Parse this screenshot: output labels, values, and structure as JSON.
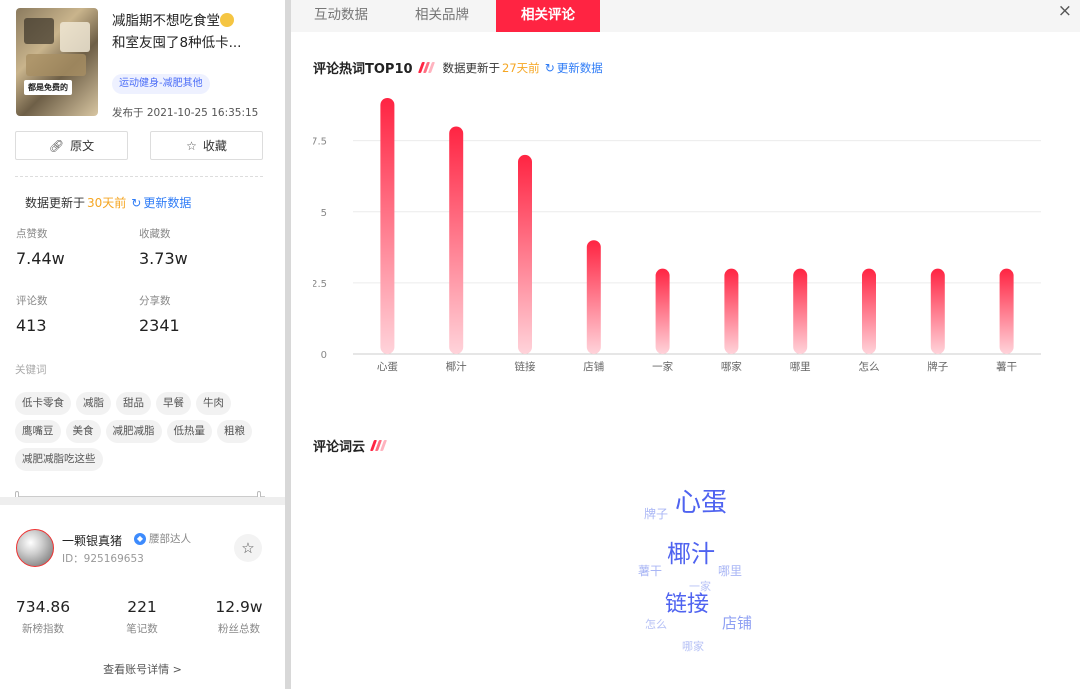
{
  "note": {
    "title": "减脂期不想吃食堂",
    "title_line2": "和室友囤了8种低卡...",
    "thumb_text": "都是免费的",
    "category": "运动健身-减肥其他",
    "publish_label": "发布于",
    "publish_time": "2021-10-25 16:35:15"
  },
  "actions": {
    "original": "原文",
    "favorite": "收藏"
  },
  "left_update": {
    "prefix": "数据更新于",
    "ago": "30天前",
    "refresh": "更新数据"
  },
  "stats": [
    {
      "label": "点赞数",
      "value": "7.44w"
    },
    {
      "label": "收藏数",
      "value": "3.73w"
    },
    {
      "label": "评论数",
      "value": "413"
    },
    {
      "label": "分享数",
      "value": "2341"
    }
  ],
  "keywords_label": "关键词",
  "keywords": [
    "低卡零食",
    "减脂",
    "甜品",
    "早餐",
    "牛肉",
    "鹰嘴豆",
    "美食",
    "减肥减脂",
    "低热量",
    "粗粮",
    "减肥减脂吃这些"
  ],
  "user": {
    "name": "一颗银真猪",
    "badge": "腰部达人",
    "id": "ID：925169653",
    "stats": [
      {
        "value": "734.86",
        "label": "新榜指数"
      },
      {
        "value": "221",
        "label": "笔记数"
      },
      {
        "value": "12.9w",
        "label": "粉丝总数"
      }
    ],
    "more": "查看账号详情 >"
  },
  "tabs": [
    "互动数据",
    "相关品牌",
    "相关评论"
  ],
  "close": "×",
  "hot_section": {
    "title": "评论热词TOP10",
    "update_prefix": "数据更新于",
    "ago": "27天前",
    "refresh": "更新数据"
  },
  "chart_data": {
    "type": "bar",
    "categories": [
      "心蛋",
      "椰汁",
      "链接",
      "店铺",
      "一家",
      "哪家",
      "哪里",
      "怎么",
      "牌子",
      "薯干"
    ],
    "values": [
      9,
      8,
      7,
      4,
      3,
      3,
      3,
      3,
      3,
      3
    ],
    "ylim": [
      0,
      9
    ],
    "yticks": [
      0,
      2.5,
      5,
      7.5
    ],
    "ytick_labels": [
      "0",
      "2.5",
      "5",
      "7.5"
    ],
    "grid": true,
    "colors": {
      "bar_top": "#ff2442",
      "bar_bottom": "#ffd3da"
    }
  },
  "cloud_section": {
    "title": "评论词云"
  },
  "word_cloud": [
    {
      "text": "心蛋",
      "size": 26,
      "color": "#4f63f0"
    },
    {
      "text": "椰汁",
      "size": 24,
      "color": "#4f63f0"
    },
    {
      "text": "链接",
      "size": 22,
      "color": "#4f63f0"
    },
    {
      "text": "店铺",
      "size": 15,
      "color": "#8fa0f3"
    },
    {
      "text": "牌子",
      "size": 12,
      "color": "#a9b6f5"
    },
    {
      "text": "薯干",
      "size": 12,
      "color": "#a9b6f5"
    },
    {
      "text": "哪里",
      "size": 12,
      "color": "#a9b6f5"
    },
    {
      "text": "一家",
      "size": 11,
      "color": "#b7c2f6"
    },
    {
      "text": "怎么",
      "size": 11,
      "color": "#b7c2f6"
    },
    {
      "text": "哪家",
      "size": 11,
      "color": "#b7c2f6"
    }
  ],
  "colors": {
    "brand": "#ff2442",
    "link": "#2f7cf6",
    "warn": "#f5a623"
  }
}
